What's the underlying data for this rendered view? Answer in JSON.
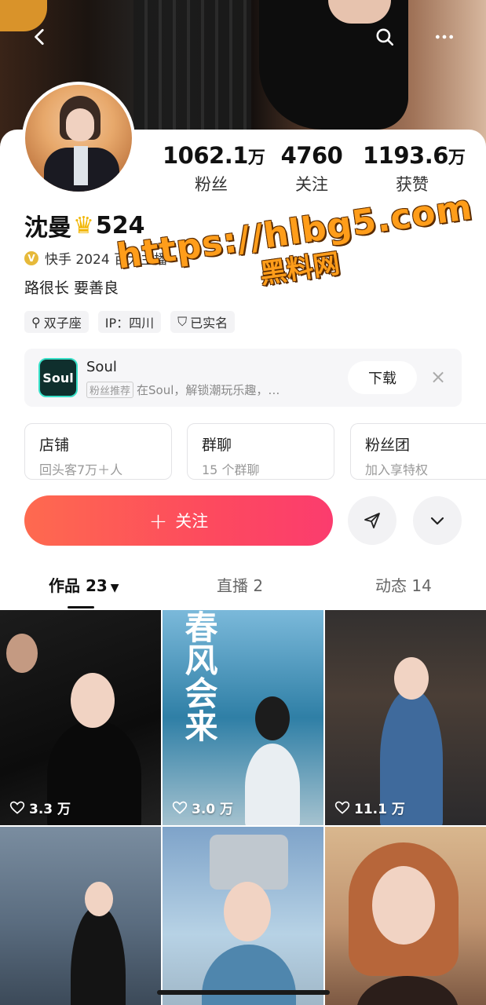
{
  "header": {
    "back_icon": "chevron-left-icon",
    "search_icon": "search-icon",
    "more_icon": "more-dots-icon"
  },
  "profile": {
    "stats": [
      {
        "value": "1062.1",
        "unit": "万",
        "label": "粉丝"
      },
      {
        "value": "4760",
        "unit": "",
        "label": "关注"
      },
      {
        "value": "1193.6",
        "unit": "万",
        "label": "获赞"
      }
    ],
    "name": "沈曼",
    "name_suffix": "524",
    "verified_text": "快手 2024 百大主播",
    "bio": "路很长 要善良",
    "tags": [
      "双子座",
      "IP：四川",
      "已实名"
    ]
  },
  "ad": {
    "logo_text": "Soul",
    "title": "Soul",
    "badge": "粉丝推荐",
    "desc": "在Soul，解锁潮玩乐趣，…",
    "download_label": "下载"
  },
  "features": [
    {
      "title": "店铺",
      "sub": "回头客7万＋人"
    },
    {
      "title": "群聊",
      "sub": "15 个群聊"
    },
    {
      "title": "粉丝团",
      "sub": "加入享特权"
    }
  ],
  "actions": {
    "follow_label": "关注",
    "colors": {
      "follow_start": "#fe6a4f",
      "follow_end": "#fb3c6e"
    }
  },
  "tabs": [
    {
      "label": "作品 23"
    },
    {
      "label": "直播 2"
    },
    {
      "label": "动态 14"
    }
  ],
  "videos": [
    {
      "likes": "3.3 万"
    },
    {
      "likes": "3.0 万",
      "overlay": "春风会来"
    },
    {
      "likes": "11.1 万"
    },
    {
      "likes": ""
    },
    {
      "likes": ""
    },
    {
      "likes": ""
    }
  ],
  "watermark": {
    "url": "https://hlbg5.com",
    "caption": "黑料网"
  }
}
